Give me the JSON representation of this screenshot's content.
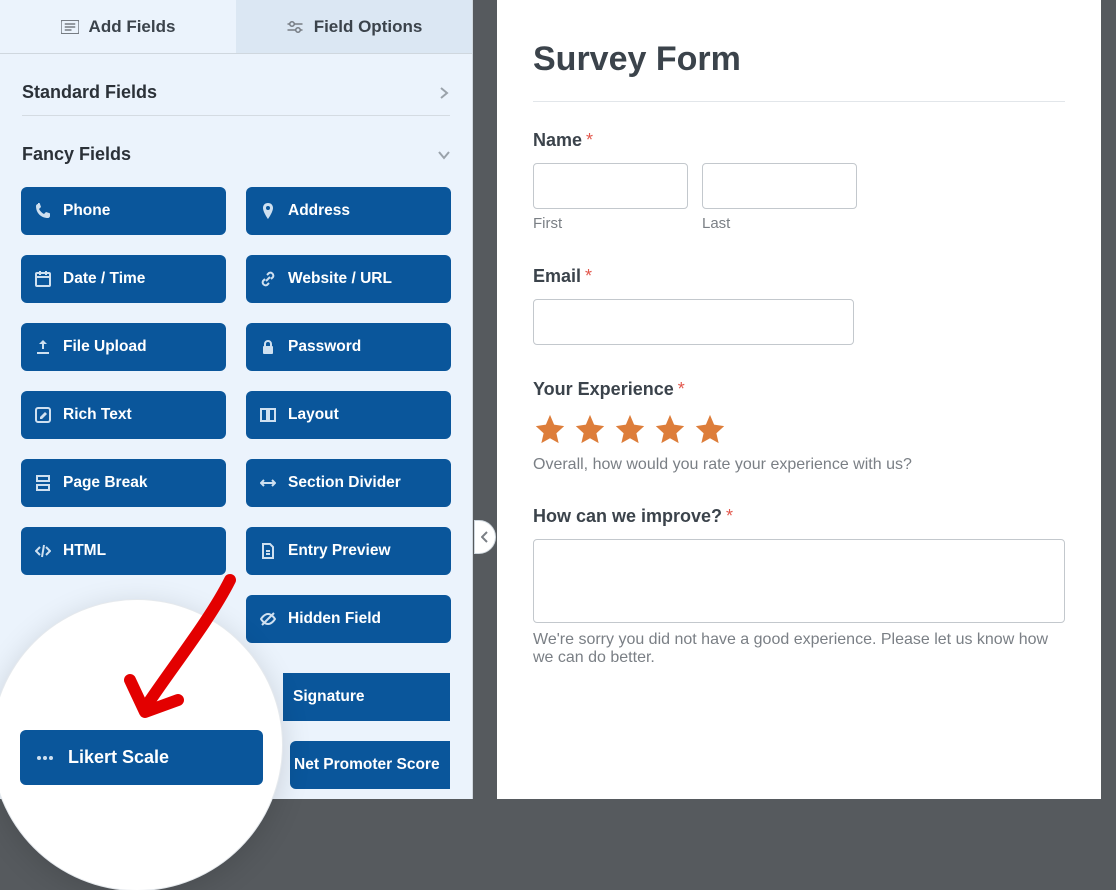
{
  "tabs": {
    "add_fields": "Add Fields",
    "field_options": "Field Options"
  },
  "sections": {
    "standard": "Standard Fields",
    "fancy": "Fancy Fields"
  },
  "fancy_fields": [
    {
      "icon": "phone-icon",
      "label": "Phone"
    },
    {
      "icon": "map-marker-icon",
      "label": "Address"
    },
    {
      "icon": "calendar-icon",
      "label": "Date / Time"
    },
    {
      "icon": "link-icon",
      "label": "Website / URL"
    },
    {
      "icon": "upload-icon",
      "label": "File Upload"
    },
    {
      "icon": "lock-icon",
      "label": "Password"
    },
    {
      "icon": "edit-icon",
      "label": "Rich Text"
    },
    {
      "icon": "columns-icon",
      "label": "Layout"
    },
    {
      "icon": "pagebreak-icon",
      "label": "Page Break"
    },
    {
      "icon": "divider-icon",
      "label": "Section Divider"
    },
    {
      "icon": "code-icon",
      "label": "HTML"
    },
    {
      "icon": "file-icon",
      "label": "Entry Preview"
    },
    {
      "icon": "star-icon",
      "label": ""
    },
    {
      "icon": "eye-slash-icon",
      "label": "Hidden Field"
    }
  ],
  "signature_label": "Signature",
  "likert_label": "Likert Scale",
  "nps_label": "Net Promoter Score",
  "form": {
    "title": "Survey Form",
    "name_label": "Name",
    "first_label": "First",
    "last_label": "Last",
    "email_label": "Email",
    "experience_label": "Your Experience",
    "experience_help": "Overall, how would you rate your experience with us?",
    "improve_label": "How can we improve?",
    "improve_help": "We're sorry you did not have a good experience. Please let us know how we can do better.",
    "required_marker": "*"
  },
  "colors": {
    "accent": "#0a569b",
    "star": "#dd7d3a",
    "arrow": "#e30000"
  }
}
